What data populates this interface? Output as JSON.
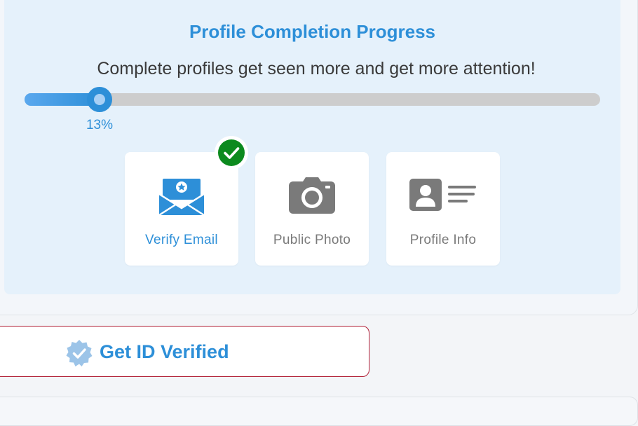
{
  "progress": {
    "title": "Profile Completion Progress",
    "subtitle": "Complete profiles get seen more and get more attention!",
    "percent": 13,
    "percent_label": "13%"
  },
  "steps": [
    {
      "label": "Verify Email",
      "icon": "email-star-icon",
      "completed": true,
      "color": "#2d8fd8"
    },
    {
      "label": "Public Photo",
      "icon": "camera-icon",
      "completed": false,
      "color": "#7a7a7a"
    },
    {
      "label": "Profile Info",
      "icon": "id-card-icon",
      "completed": false,
      "color": "#7a7a7a"
    }
  ],
  "verify_button": {
    "label": "Get ID Verified",
    "icon": "verified-badge-icon"
  },
  "colors": {
    "accent": "#2d8fd8",
    "panel_bg": "#e5f1fb",
    "track": "#cdcdcd",
    "complete_green": "#0c8a1e",
    "button_border": "#b01e35",
    "muted_icon": "#7a7a7a"
  }
}
